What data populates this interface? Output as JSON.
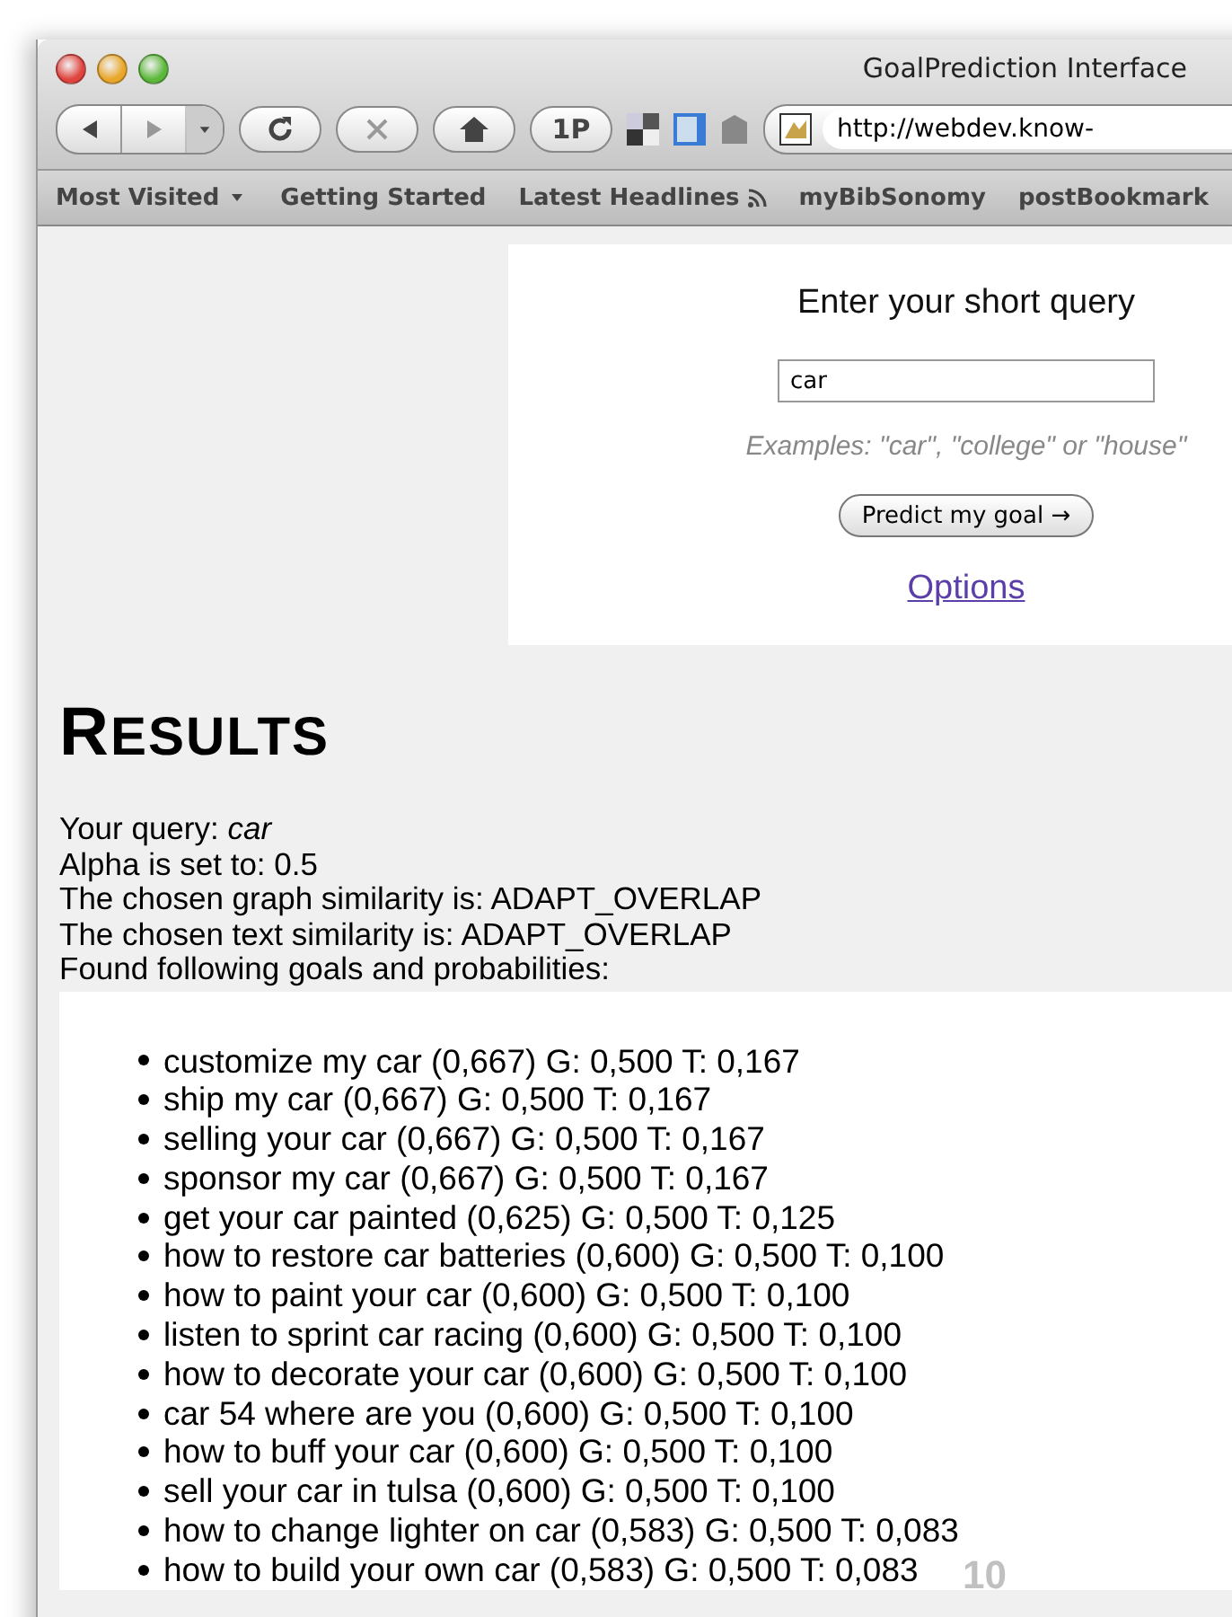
{
  "window": {
    "title": "GoalPrediction Interface"
  },
  "toolbar": {
    "address": "http://webdev.know-",
    "home_label": "1P"
  },
  "bookmarks": [
    {
      "label": "Most Visited",
      "kind": "menu"
    },
    {
      "label": "Getting Started",
      "kind": "plain"
    },
    {
      "label": "Latest Headlines",
      "kind": "feed"
    },
    {
      "label": "myBibSonomy",
      "kind": "plain"
    },
    {
      "label": "postBookmark",
      "kind": "plain"
    }
  ],
  "query_form": {
    "heading": "Enter your short query",
    "query": "car",
    "examples": "Examples: \"car\", \"college\" or \"house\"",
    "submit": "Predict my goal →",
    "options_link": "Options"
  },
  "results": {
    "heading": "RESULTS",
    "lines": [
      "Your query: *car*",
      "Alpha is set to: 0.5",
      "The chosen graph similarity is: ADAPT_OVERLAP",
      "The chosen text similarity is: ADAPT_OVERLAP",
      "Found following goals and probabilities:"
    ],
    "goals": [
      "customize my car (0,667) G: 0,500 T: 0,167",
      "ship my car (0,667) G: 0,500 T: 0,167",
      "selling your car (0,667) G: 0,500 T: 0,167",
      "sponsor my car (0,667) G: 0,500 T: 0,167",
      "get your car painted (0,625) G: 0,500 T: 0,125",
      "how to restore car batteries (0,600) G: 0,500 T: 0,100",
      "how to paint your car (0,600) G: 0,500 T: 0,100",
      "listen to sprint car racing (0,600) G: 0,500 T: 0,100",
      "how to decorate your car (0,600) G: 0,500 T: 0,100",
      "car 54 where are you (0,600) G: 0,500 T: 0,100",
      "how to buff your car (0,600) G: 0,500 T: 0,100",
      "sell your car in tulsa (0,600) G: 0,500 T: 0,100",
      "how to change lighter on car (0,583) G: 0,500 T: 0,083",
      "how to build your own car (0,583) G: 0,500 T: 0,083"
    ]
  },
  "page_number": "10"
}
